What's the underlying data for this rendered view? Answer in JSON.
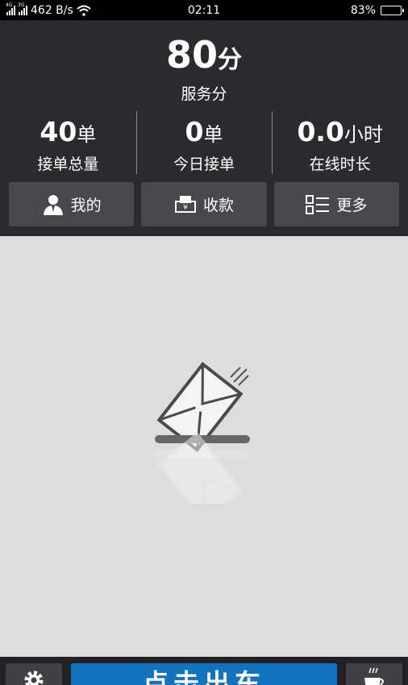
{
  "status_bar": {
    "network_1": "4G",
    "network_2": "3G",
    "speed": "462 B/s",
    "time": "02:11",
    "battery": "83%",
    "battery_level": 0.83
  },
  "header": {
    "score": {
      "value": "80",
      "unit": "分",
      "label": "服务分"
    },
    "stats": [
      {
        "value": "40",
        "unit": "单",
        "label": "接单总量"
      },
      {
        "value": "0",
        "unit": "单",
        "label": "今日接单"
      },
      {
        "value": "0.0",
        "unit": "小时",
        "label": "在线时长"
      }
    ],
    "buttons": [
      {
        "label": "我的",
        "icon": "user-icon"
      },
      {
        "label": "收款",
        "icon": "payment-icon"
      },
      {
        "label": "更多",
        "icon": "list-icon"
      }
    ]
  },
  "main": {
    "illustration": "empty-mailbox-icon"
  },
  "bottom_bar": {
    "settings_icon": "gear-icon",
    "main_button_label": "点击出车",
    "break_icon": "coffee-cup-icon"
  },
  "colors": {
    "header_bg": "#2b2b2f",
    "button_bg": "#49494d",
    "content_bg": "#dcdddc",
    "primary_blue": "#1573bd"
  }
}
